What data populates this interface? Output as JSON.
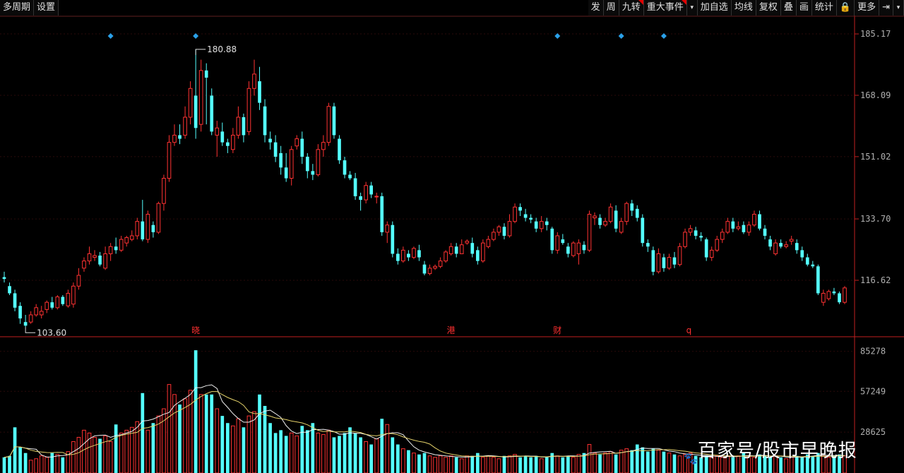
{
  "toolbar": {
    "left": [
      "多周期",
      "设置"
    ],
    "right": [
      "发",
      "周",
      "九转",
      "重大事件",
      "▾",
      "加自选",
      "均线",
      "复权",
      "叠",
      "画",
      "统计",
      "🔒",
      "更多",
      "⇥",
      "▾"
    ]
  },
  "colors": {
    "up": "#ff3232",
    "down": "#54ffff",
    "axis": "#c02020",
    "label": "#b0b0b0",
    "diamond": "#1e90ff",
    "ma_yellow": "#e6d36b",
    "ma_white": "#f0f0f0"
  },
  "price_annotations": {
    "high": "180.88",
    "low": "103.60"
  },
  "event_markers": [
    "晓",
    "港",
    "财",
    "q"
  ],
  "watermark": "百家号/股市早晚报",
  "chart_data": {
    "type": "candlestick",
    "price_axis": {
      "ticks": [
        "185.17",
        "168.09",
        "151.02",
        "133.70",
        "116.62"
      ],
      "range": [
        101.5,
        189.5
      ]
    },
    "volume_axis": {
      "ticks": [
        "85278",
        "57249",
        "28625"
      ],
      "range": [
        0,
        92000
      ]
    },
    "candles": [
      [
        117.5,
        117.0,
        119.0,
        116.0,
        11000
      ],
      [
        115.0,
        113.0,
        116.0,
        112.5,
        12000
      ],
      [
        113.0,
        109.0,
        114.0,
        108.0,
        32000
      ],
      [
        109.5,
        106.0,
        110.5,
        104.5,
        18000
      ],
      [
        105.0,
        104.0,
        107.0,
        103.6,
        14000
      ],
      [
        105.0,
        107.0,
        108.0,
        104.5,
        9000
      ],
      [
        107.0,
        109.0,
        110.0,
        106.5,
        10000
      ],
      [
        107.0,
        108.0,
        109.5,
        106.0,
        12000
      ],
      [
        108.5,
        110.5,
        111.0,
        107.5,
        11000
      ],
      [
        110.5,
        109.0,
        112.0,
        108.5,
        14000
      ],
      [
        109.0,
        112.0,
        112.5,
        108.5,
        13000
      ],
      [
        112.0,
        110.0,
        112.5,
        109.5,
        11000
      ],
      [
        109.5,
        113.0,
        114.0,
        109.0,
        15000
      ],
      [
        110.0,
        115.0,
        116.0,
        109.0,
        22000
      ],
      [
        115.0,
        118.0,
        120.0,
        114.0,
        25000
      ],
      [
        120.0,
        122.0,
        123.0,
        119.0,
        30000
      ],
      [
        122.0,
        124.0,
        126.0,
        121.0,
        28000
      ],
      [
        123.0,
        123.5,
        125.0,
        122.0,
        25000
      ],
      [
        123.5,
        121.0,
        124.5,
        120.5,
        24000
      ],
      [
        120.0,
        124.0,
        126.0,
        119.5,
        26000
      ],
      [
        124.0,
        126.0,
        127.0,
        122.0,
        22000
      ],
      [
        126.0,
        125.0,
        128.5,
        124.0,
        34000
      ],
      [
        125.0,
        128.0,
        129.0,
        124.5,
        28000
      ],
      [
        127.0,
        128.5,
        129.0,
        126.0,
        30000
      ],
      [
        128.0,
        129.0,
        130.5,
        127.5,
        32000
      ],
      [
        129.0,
        133.0,
        134.0,
        128.0,
        36000
      ],
      [
        133.0,
        128.0,
        139.0,
        127.5,
        56000
      ],
      [
        128.0,
        135.0,
        136.0,
        127.0,
        30000
      ],
      [
        132.0,
        130.0,
        133.0,
        128.5,
        35000
      ],
      [
        130.0,
        138.0,
        138.5,
        129.5,
        40000
      ],
      [
        138.0,
        145.0,
        146.0,
        136.0,
        45000
      ],
      [
        145.0,
        155.0,
        157.0,
        144.0,
        62000
      ],
      [
        155.0,
        157.0,
        160.0,
        154.0,
        55000
      ],
      [
        157.0,
        156.0,
        160.0,
        154.5,
        48000
      ],
      [
        157.0,
        162.0,
        165.0,
        156.0,
        52000
      ],
      [
        162.0,
        170.0,
        172.0,
        160.0,
        58000
      ],
      [
        168.0,
        159.0,
        180.88,
        156.0,
        86000
      ],
      [
        160.0,
        175.0,
        178.0,
        158.0,
        55000
      ],
      [
        175.0,
        173.0,
        177.0,
        160.0,
        55000
      ],
      [
        168.0,
        158.0,
        170.0,
        157.0,
        55000
      ],
      [
        157.0,
        159.0,
        161.0,
        151.0,
        45000
      ],
      [
        158.0,
        155.0,
        160.5,
        154.0,
        40000
      ],
      [
        155.0,
        154.0,
        156.0,
        152.0,
        35000
      ],
      [
        153.0,
        157.0,
        159.0,
        152.0,
        33000
      ],
      [
        157.0,
        162.0,
        165.0,
        156.0,
        38000
      ],
      [
        162.0,
        157.0,
        163.0,
        155.0,
        32000
      ],
      [
        158.0,
        170.0,
        172.0,
        157.0,
        40000
      ],
      [
        170.0,
        174.0,
        178.0,
        168.0,
        43000
      ],
      [
        172.0,
        166.0,
        176.0,
        164.0,
        55000
      ],
      [
        165.0,
        157.0,
        167.0,
        155.0,
        47000
      ],
      [
        156.0,
        155.0,
        158.0,
        153.0,
        35000
      ],
      [
        155.0,
        151.0,
        157.0,
        149.5,
        28000
      ],
      [
        152.0,
        148.0,
        154.0,
        146.0,
        30000
      ],
      [
        148.0,
        145.0,
        152.0,
        144.0,
        26000
      ],
      [
        145.0,
        153.0,
        154.0,
        143.0,
        28000
      ],
      [
        154.0,
        156.0,
        157.0,
        153.0,
        26000
      ],
      [
        156.0,
        151.0,
        158.0,
        149.0,
        33000
      ],
      [
        151.0,
        147.0,
        152.0,
        145.0,
        30000
      ],
      [
        147.0,
        146.0,
        149.0,
        144.5,
        35000
      ],
      [
        146.0,
        153.0,
        154.5,
        145.5,
        28000
      ],
      [
        153.0,
        155.0,
        157.0,
        151.0,
        27000
      ],
      [
        155.0,
        165.0,
        166.0,
        154.0,
        30000
      ],
      [
        165.0,
        157.0,
        166.0,
        156.0,
        25000
      ],
      [
        156.0,
        150.0,
        157.0,
        149.0,
        26000
      ],
      [
        150.0,
        146.0,
        151.0,
        145.0,
        28000
      ],
      [
        146.0,
        145.0,
        147.0,
        144.5,
        32000
      ],
      [
        145.0,
        140.0,
        146.5,
        139.0,
        28000
      ],
      [
        140.0,
        139.0,
        141.0,
        136.0,
        25000
      ],
      [
        139.0,
        143.0,
        144.0,
        138.0,
        22000
      ],
      [
        143.0,
        140.5,
        144.0,
        139.5,
        20000
      ],
      [
        140.0,
        140.0,
        141.0,
        138.0,
        24000
      ],
      [
        140.0,
        130.0,
        141.0,
        129.0,
        38000
      ],
      [
        130.0,
        132.0,
        133.0,
        127.0,
        34000
      ],
      [
        132.0,
        124.0,
        133.0,
        123.0,
        25000
      ],
      [
        124.0,
        122.0,
        125.5,
        121.0,
        20000
      ],
      [
        122.0,
        125.0,
        126.0,
        121.5,
        17000
      ],
      [
        124.0,
        123.0,
        125.0,
        122.0,
        16000
      ],
      [
        123.0,
        125.5,
        126.0,
        122.5,
        14000
      ],
      [
        125.0,
        123.0,
        126.5,
        122.0,
        13000
      ],
      [
        121.0,
        118.5,
        122.0,
        118.0,
        14000
      ],
      [
        118.5,
        120.0,
        121.0,
        118.0,
        12000
      ],
      [
        120.0,
        120.5,
        121.0,
        119.5,
        11000
      ],
      [
        120.5,
        122.0,
        123.0,
        120.0,
        12000
      ],
      [
        122.0,
        124.5,
        125.0,
        121.5,
        11000
      ],
      [
        124.0,
        126.0,
        127.0,
        123.5,
        12000
      ],
      [
        126.0,
        124.0,
        127.0,
        123.0,
        11000
      ],
      [
        124.0,
        126.5,
        128.0,
        124.0,
        10000
      ],
      [
        127.0,
        127.5,
        128.0,
        126.5,
        12000
      ],
      [
        127.0,
        124.0,
        128.5,
        123.0,
        12000
      ],
      [
        125.0,
        122.0,
        126.0,
        121.0,
        14000
      ],
      [
        122.0,
        127.0,
        128.0,
        121.5,
        11000
      ],
      [
        126.0,
        128.0,
        129.0,
        125.5,
        12000
      ],
      [
        128.0,
        130.0,
        131.0,
        127.5,
        11000
      ],
      [
        130.0,
        131.5,
        132.0,
        129.0,
        10000
      ],
      [
        131.5,
        129.0,
        132.5,
        128.0,
        12000
      ],
      [
        129.0,
        133.0,
        135.0,
        128.5,
        12000
      ],
      [
        133.0,
        137.0,
        138.0,
        132.5,
        13000
      ],
      [
        137.0,
        136.0,
        138.0,
        134.5,
        11000
      ],
      [
        135.0,
        134.0,
        136.5,
        133.0,
        12000
      ],
      [
        134.0,
        133.5,
        135.0,
        132.5,
        11000
      ],
      [
        133.0,
        131.0,
        134.0,
        130.0,
        12000
      ],
      [
        131.0,
        133.0,
        134.5,
        130.0,
        10000
      ],
      [
        133.0,
        132.0,
        134.0,
        130.5,
        11000
      ],
      [
        131.0,
        125.0,
        131.5,
        124.0,
        14000
      ],
      [
        125.0,
        129.0,
        130.0,
        124.0,
        12000
      ],
      [
        128.0,
        127.0,
        129.5,
        126.5,
        11000
      ],
      [
        126.0,
        124.0,
        127.0,
        123.0,
        12000
      ],
      [
        123.5,
        127.0,
        127.5,
        123.0,
        11000
      ],
      [
        124.0,
        127.0,
        128.0,
        121.0,
        13000
      ],
      [
        126.5,
        125.0,
        127.5,
        124.0,
        14000
      ],
      [
        125.0,
        135.0,
        136.0,
        124.5,
        20000
      ],
      [
        134.0,
        134.5,
        135.5,
        132.0,
        14000
      ],
      [
        134.0,
        132.0,
        135.0,
        131.0,
        13000
      ],
      [
        132.0,
        133.0,
        134.0,
        131.5,
        14000
      ],
      [
        133.0,
        137.0,
        138.0,
        132.5,
        15000
      ],
      [
        136.0,
        131.0,
        137.5,
        130.0,
        13000
      ],
      [
        130.0,
        133.0,
        134.0,
        129.5,
        16000
      ],
      [
        133.0,
        138.0,
        138.5,
        132.0,
        17000
      ],
      [
        138.0,
        136.0,
        139.0,
        134.5,
        16000
      ],
      [
        136.5,
        134.0,
        137.5,
        133.0,
        20000
      ],
      [
        134.0,
        127.0,
        135.0,
        126.0,
        18000
      ],
      [
        127.0,
        126.0,
        128.0,
        124.5,
        15000
      ],
      [
        125.0,
        119.0,
        126.0,
        118.0,
        17000
      ],
      [
        119.0,
        124.0,
        125.5,
        118.5,
        16000
      ],
      [
        123.0,
        120.0,
        124.0,
        119.0,
        15000
      ],
      [
        120.0,
        123.0,
        124.0,
        119.5,
        14000
      ],
      [
        123.0,
        121.0,
        124.5,
        120.0,
        13000
      ],
      [
        121.0,
        126.0,
        127.0,
        120.5,
        12000
      ],
      [
        126.0,
        130.0,
        131.0,
        125.5,
        13000
      ],
      [
        130.0,
        131.0,
        132.0,
        129.0,
        14000
      ],
      [
        130.5,
        129.0,
        131.5,
        128.0,
        12000
      ],
      [
        129.0,
        128.5,
        130.0,
        127.5,
        11000
      ],
      [
        128.0,
        123.0,
        128.5,
        122.0,
        12000
      ],
      [
        123.0,
        125.0,
        126.0,
        122.0,
        11000
      ],
      [
        125.0,
        128.0,
        129.0,
        124.5,
        12000
      ],
      [
        128.0,
        130.0,
        131.0,
        127.0,
        11000
      ],
      [
        130.0,
        133.0,
        134.0,
        129.5,
        12000
      ],
      [
        133.0,
        131.0,
        134.0,
        130.0,
        11000
      ],
      [
        131.0,
        131.5,
        133.0,
        130.5,
        12000
      ],
      [
        132.0,
        130.0,
        133.0,
        129.5,
        14000
      ],
      [
        130.0,
        132.0,
        133.0,
        129.0,
        12000
      ],
      [
        132.0,
        135.0,
        136.0,
        131.5,
        11000
      ],
      [
        135.0,
        131.0,
        136.0,
        130.5,
        13000
      ],
      [
        131.0,
        129.0,
        132.0,
        128.0,
        12000
      ],
      [
        128.0,
        126.0,
        129.0,
        125.0,
        11000
      ],
      [
        124.0,
        127.0,
        128.0,
        123.5,
        12000
      ],
      [
        127.0,
        126.0,
        128.0,
        125.5,
        11000
      ],
      [
        126.0,
        126.5,
        127.5,
        125.5,
        10000
      ],
      [
        127.5,
        128.0,
        129.0,
        126.5,
        11000
      ],
      [
        127.0,
        125.0,
        128.0,
        124.0,
        12000
      ],
      [
        125.0,
        123.0,
        126.0,
        122.0,
        11000
      ],
      [
        123.0,
        121.0,
        124.0,
        120.5,
        13000
      ],
      [
        121.0,
        120.5,
        122.0,
        120.0,
        12000
      ],
      [
        120.5,
        113.0,
        121.0,
        112.5,
        14000
      ],
      [
        110.5,
        113.0,
        114.0,
        109.5,
        12000
      ],
      [
        111.5,
        113.5,
        114.0,
        111.0,
        11000
      ],
      [
        113.5,
        113.0,
        114.5,
        112.5,
        12000
      ],
      [
        113.0,
        110.5,
        113.5,
        110.0,
        13000
      ],
      [
        110.5,
        114.5,
        115.0,
        110.0,
        12000
      ]
    ]
  }
}
